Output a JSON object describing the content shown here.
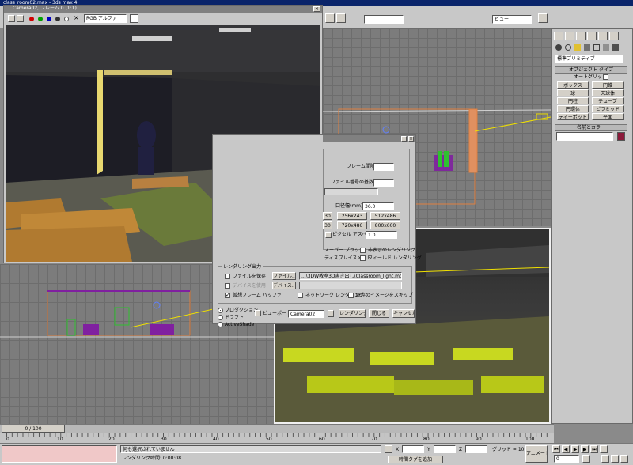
{
  "app": {
    "title_fragment": "class_room02.max - 3ds max 4",
    "toolbar_dropdown_view": "ビュー"
  },
  "framebuffer": {
    "title": "Camera02, フレーム 0 (1:1)",
    "channel_dropdown": "RGB アルファ"
  },
  "command_panel": {
    "category_dropdown": "標準プリミティブ",
    "object_type_header": "オブジェクト タイプ",
    "autogrid_label": "オートグリッド",
    "buttons": [
      "ボックス",
      "円錐",
      "球",
      "天球体",
      "円柱",
      "チューブ",
      "円環体",
      "ピラミッド",
      "ティーポット",
      "平面"
    ],
    "name_color_header": "名前とカラー"
  },
  "render_dialog": {
    "frame_step_label": "フレーム間隔",
    "file_number_label": "ファイル番号の基数",
    "aperture_label": "口径幅(mm)",
    "aperture_value": "36.0",
    "sizes": [
      "256x243",
      "512x486",
      "720x486",
      "800x600"
    ],
    "size_left_partial": [
      "30",
      "30"
    ],
    "pixel_aspect_label": "ピクセル アスペクト",
    "pixel_aspect_value": "1.0",
    "super_black_label": "スーパー ブラック",
    "hidden_render_label": "非表示のレンダリング",
    "displacement_label": "ディスプレイスメント",
    "field_render_label": "フィールド レンダリング",
    "output_header": "レンダリング出力",
    "save_file_label": "ファイルを保存",
    "files_button": "ファイル...",
    "output_path": "...\\3DW教室3D書き出し\\Classroom_light.mov",
    "use_device_label": "デバイスを使用",
    "devices_button": "デバイス...",
    "virtual_fb_label": "仮想フレーム バッファ",
    "net_render_label": "ネットワーク レンダリング",
    "skip_existing_label": "既存のイメージをスキップ",
    "production_label": "プロダクション",
    "draft_label": "ドラフト",
    "activeshade_label": "ActiveShade",
    "viewport_label": "ビューポート:",
    "viewport_value": "Camera02",
    "render_button": "レンダリング",
    "close_button": "閉じる",
    "cancel_button": "キャンセル"
  },
  "status": {
    "frame_counter": "0 / 100",
    "timeline_ticks": [
      "0",
      "10",
      "20",
      "30",
      "40",
      "50",
      "60",
      "70",
      "80",
      "90",
      "100"
    ],
    "selection_text": "何も選択されていません",
    "render_time": "レンダリング時間: 0:00:08",
    "x_label": "X",
    "y_label": "Y",
    "z_label": "Z",
    "grid_label": "グリッド = 10.0",
    "add_time_tag": "時間タグを追加",
    "animate_button": "アニメート",
    "frame_field": "0"
  },
  "colors": {
    "title_active": "#0a246a",
    "title_inactive": "#808080",
    "name_color_swatch": "#8b1a3a",
    "wire_orange": "#e08040",
    "wire_purple": "#8020a0"
  }
}
